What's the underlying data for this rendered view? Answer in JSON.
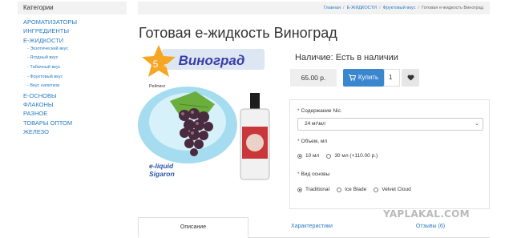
{
  "sidebar": {
    "heading": "Категории",
    "items_top": [
      "АРОМАТИЗАТОРЫ",
      "ИНГРЕДИЕНТЫ",
      "Е-ЖИДКОСТИ"
    ],
    "subitems": [
      "- Экзотический вкус",
      "- Ягодный вкус",
      "- Табачный вкус",
      "- Фруктовый вкус",
      "- Вкус напитков"
    ],
    "items_bottom": [
      "Е-ОСНОВЫ",
      "ФЛАКОНЫ",
      "РАЗНОЕ",
      "ТОВАРЫ ОПТОМ",
      "ЖЕЛЕЗО"
    ]
  },
  "breadcrumb": {
    "items": [
      "Главная",
      "Е-ЖИДКОСТИ",
      "Фруктовый вкус"
    ],
    "separator": "/",
    "current": "Готовая е-жидкость Виноград"
  },
  "product": {
    "title": "Готовая е-жидкость Виноград",
    "image": {
      "banner_text": "Виноград",
      "rating_value": "5",
      "rating_suffix": "/5",
      "rating_label": "Рейтинг",
      "brand_line1": "e-liquid",
      "brand_line2": "Sigaron"
    },
    "availability": "Наличие: Есть в наличии",
    "price": "65.00 р.",
    "buy_label": "Купить",
    "quantity": "1"
  },
  "options": {
    "nicotine": {
      "label": "Содержание Nic.",
      "selected": "24 мг\\мл"
    },
    "volume": {
      "label": "Объем, мл",
      "choices": [
        "10 мл",
        "30 мл (+110.00 р.)"
      ],
      "selected_index": 0
    },
    "base": {
      "label": "Вид основы",
      "choices": [
        "Traditional",
        "Ice Blade",
        "Velvet Cloud"
      ],
      "selected_index": 0
    },
    "required_mark": "*"
  },
  "tabs": [
    "Описание",
    "Характеристики",
    "Отзывы (6)"
  ],
  "watermark": "YAPLAKAL.COM",
  "colors": {
    "link": "#2a7bc4",
    "buy_button": "#3a86cf",
    "star": "#f6a623",
    "required": "#e02020"
  }
}
